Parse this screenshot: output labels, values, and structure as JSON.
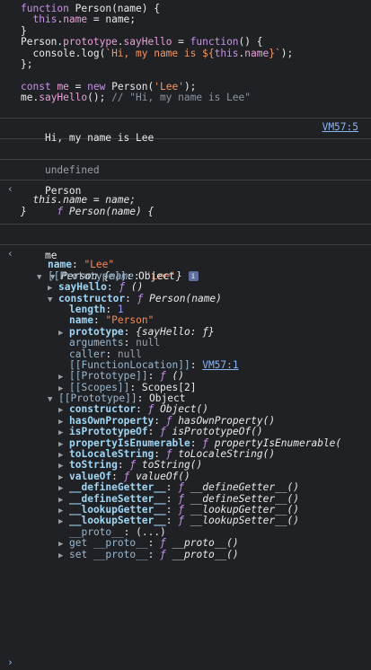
{
  "code": {
    "l1_kw": "function",
    "l1_name": "Person",
    "l1_rest": "(name) {",
    "l2_indent": "  ",
    "l2_this": "this",
    "l2_dot": ".",
    "l2_prop": "name",
    "l2_rest": " = name;",
    "l3": "}",
    "l4_obj": "Person",
    "l4_proto": "prototype",
    "l4_say": "sayHello",
    "l4_eq": " = ",
    "l4_kw": "function",
    "l4_rest": "() {",
    "l5_console": "  console.",
    "l5_log": "log",
    "l5_tpl_a": "`Hi, my name is ${",
    "l5_this": "this",
    "l5_name": "name",
    "l5_tpl_b": "}`",
    "l5_rest": ");",
    "l6": "};",
    "l8_kw": "const",
    "l8_me": "me",
    "l8_eq": " = ",
    "l8_new": "new",
    "l8_person": " Person(",
    "l8_str": "'Lee'",
    "l8_rest": ");",
    "l9_me": "me.",
    "l9_say": "sayHello",
    "l9_rest": "(); ",
    "l9_cmt": "// \"Hi, my name is Lee\""
  },
  "output": {
    "log_text": "Hi, my name is Lee",
    "log_source": "VM57:5",
    "undefined": "undefined",
    "input2": "Person",
    "fn_f": "f",
    "fn_sig": "Person(name) {",
    "fn_body": "  this.name = name;",
    "fn_close": "}",
    "input3": "me"
  },
  "tree": {
    "root_label": "Person",
    "root_preview_open": "{",
    "root_preview_key": "name",
    "root_preview_val": "'Lee'",
    "root_preview_close": "}",
    "info_icon": "i",
    "name_key": "name",
    "name_val": "\"Lee\"",
    "proto1_key": "[[Prototype]]",
    "proto1_val": "Object",
    "sayHello_key": "sayHello",
    "sayHello_val": "()",
    "constructor_key": "constructor",
    "constructor_val": "Person(name)",
    "length_key": "length",
    "length_val": "1",
    "cname_key": "name",
    "cname_val": "\"Person\"",
    "cproto_key": "prototype",
    "cproto_val": "{sayHello: ƒ}",
    "arguments_key": "arguments",
    "arguments_val": "null",
    "caller_key": "caller",
    "caller_val": "null",
    "fnloc_key": "[[FunctionLocation]]",
    "fnloc_val": "VM57:1",
    "cproto2_key": "[[Prototype]]",
    "cproto2_val": "()",
    "scopes_key": "[[Scopes]]",
    "scopes_val": "Scopes[2]",
    "proto2_key": "[[Prototype]]",
    "proto2_val": "Object",
    "obj_items": [
      {
        "key": "constructor",
        "val": "Object()"
      },
      {
        "key": "hasOwnProperty",
        "val": "hasOwnProperty()"
      },
      {
        "key": "isPrototypeOf",
        "val": "isPrototypeOf()"
      },
      {
        "key": "propertyIsEnumerable",
        "val": "propertyIsEnumerable("
      },
      {
        "key": "toLocaleString",
        "val": "toLocaleString()"
      },
      {
        "key": "toString",
        "val": "toString()"
      },
      {
        "key": "valueOf",
        "val": "valueOf()"
      },
      {
        "key": "__defineGetter__",
        "val": "__defineGetter__()"
      },
      {
        "key": "__defineSetter__",
        "val": "__defineSetter__()"
      },
      {
        "key": "__lookupGetter__",
        "val": "__lookupGetter__()"
      },
      {
        "key": "__lookupSetter__",
        "val": "__lookupSetter__()"
      }
    ],
    "proto_accessor_key": "__proto__",
    "proto_accessor_val": "(...)",
    "get_proto_label": "get __proto__",
    "get_proto_val": "__proto__()",
    "set_proto_label": "set __proto__",
    "set_proto_val": "__proto__()"
  },
  "prompt_caret": "›",
  "return_arrow": "‹",
  "f_glyph": "ƒ",
  "colors": {
    "background": "#202124",
    "keyword": "#c792ea",
    "string": "#f29766",
    "link": "#8ab4f8",
    "key": "#9fd6f5",
    "number": "#9999ff"
  }
}
